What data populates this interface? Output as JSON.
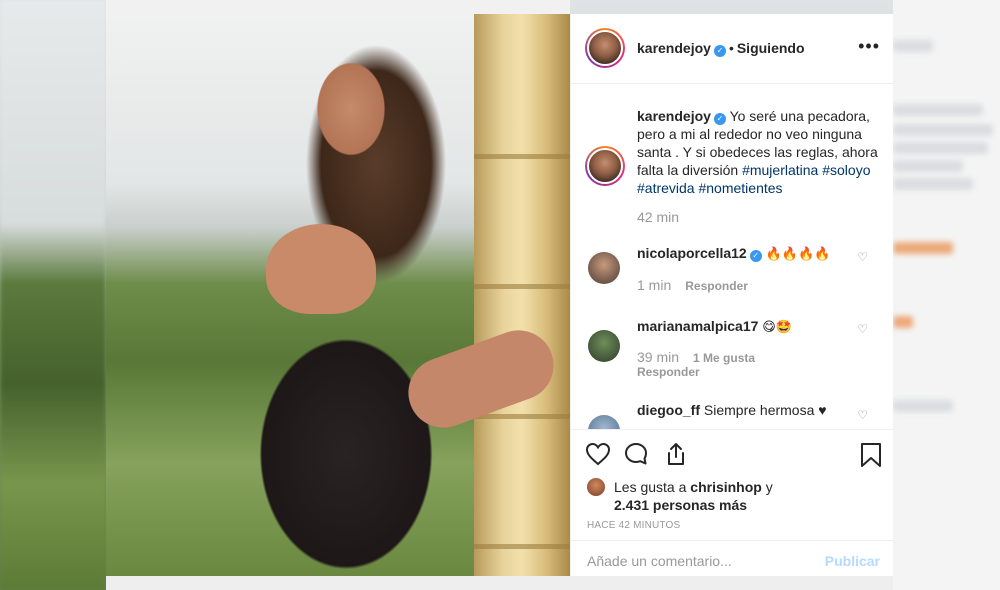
{
  "post": {
    "username": "karendejoy",
    "follow_status": "Siguiendo",
    "more_icon": "more-horizontal-icon",
    "caption_prefix": "Yo seré una pecadora, pero a mi al rededor no veo ninguna santa . Y si obedeces las reglas, ahora falta la diversión ",
    "hashtags": [
      "#mujerlatina",
      "#soloyo",
      "#atrevida",
      "#nometientes"
    ],
    "caption_time": "42 min"
  },
  "comments": [
    {
      "username": "nicolaporcella12",
      "verified": true,
      "text": "🔥🔥🔥🔥",
      "time": "1 min",
      "reply": "Responder",
      "likes": ""
    },
    {
      "username": "marianamalpica17",
      "verified": false,
      "text": "😋🤩",
      "time": "39 min",
      "likes": "1 Me gusta",
      "reply": "Responder"
    },
    {
      "username": "diegoo_ff",
      "verified": false,
      "text": "Siempre hermosa ♥"
    }
  ],
  "actions": {
    "like_icon": "heart-icon",
    "comment_icon": "comment-icon",
    "share_icon": "share-icon",
    "save_icon": "bookmark-icon"
  },
  "likes": {
    "prefix": "Les gusta a ",
    "user": "chrisinhop",
    "suffix": " y",
    "count": "2.431 personas más"
  },
  "time_ago": "HACE 42 MINUTOS",
  "add_comment": {
    "placeholder": "Añade un comentario...",
    "publish": "Publicar"
  },
  "colors": {
    "link": "#003569",
    "verified": "#3897f0",
    "publish_disabled": "#b3dbff"
  }
}
